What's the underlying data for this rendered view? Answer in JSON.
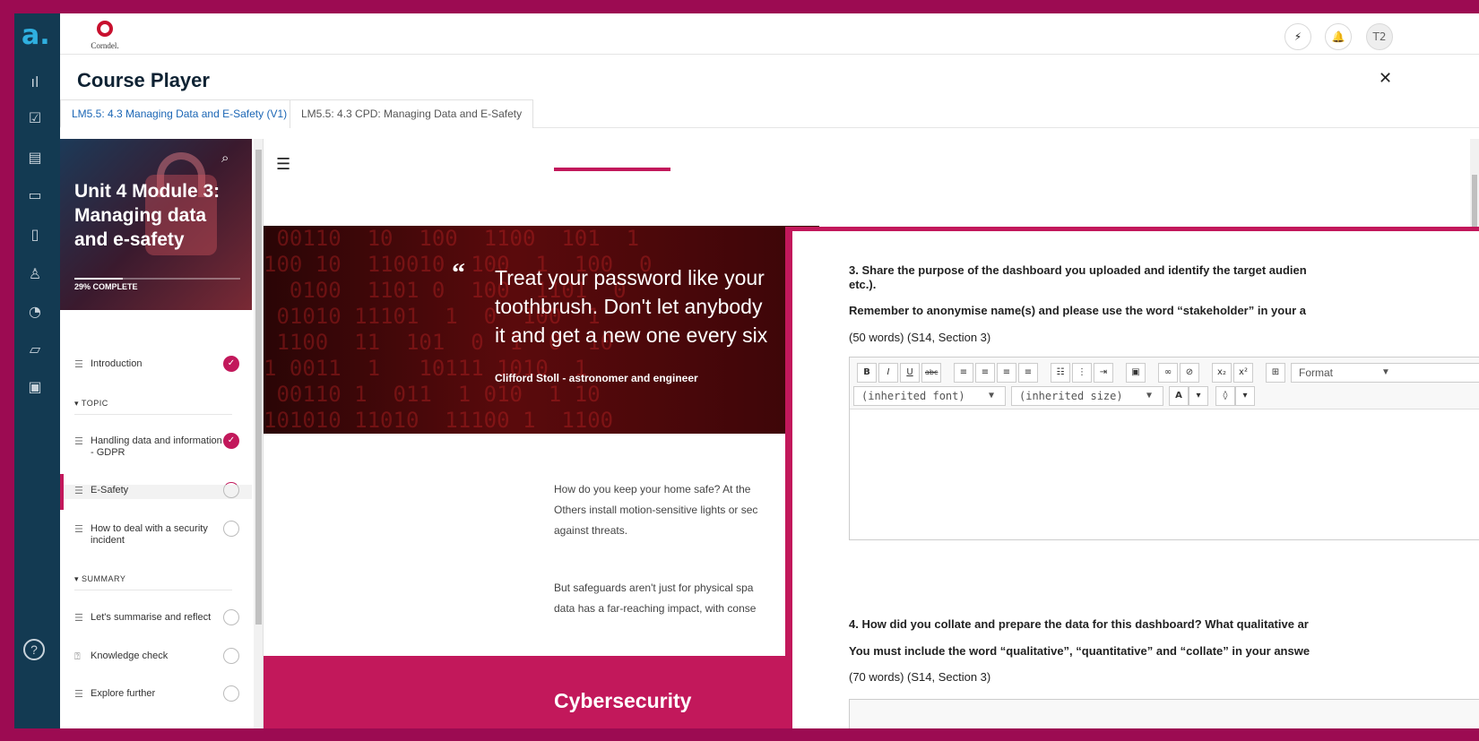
{
  "rail": {
    "logo": "a.",
    "items": [
      "bar-chart-icon",
      "checkbox-icon",
      "clipboard-icon",
      "chat-icon",
      "document-icon",
      "user-icon",
      "pie-chart-icon",
      "badge-icon",
      "video-doc-icon"
    ],
    "glyphs": [
      "ıl",
      "☑",
      "▤",
      "▭",
      "▯",
      "♙",
      "◔",
      "▱",
      "▣"
    ],
    "help": "?"
  },
  "topbar": {
    "brand": "Corndel.",
    "user_initials": "T2",
    "flash_glyph": "⚡",
    "bell_glyph": "🔔"
  },
  "player": {
    "title": "Course Player",
    "close": "✕",
    "tabs": [
      {
        "label": "LM5.5: 4.3 Managing Data and E-Safety (V1)",
        "active": true
      },
      {
        "label": "LM5.5: 4.3 CPD: Managing Data and E-Safety",
        "active": false
      }
    ]
  },
  "course": {
    "title": "Unit 4 Module 3: Managing data and e-safety",
    "progress_label": "29% COMPLETE",
    "progress": 0.29,
    "lessons": [
      {
        "icon": "lines-icon",
        "label": "Introduction",
        "status": "complete"
      },
      {
        "icon": "lines-icon",
        "label": "Handling data and information - GDPR",
        "status": "complete"
      },
      {
        "icon": "lines-icon",
        "label": "E-Safety",
        "status": "in-progress"
      },
      {
        "icon": "lines-icon",
        "label": "How to deal with a security incident",
        "status": "not-started"
      },
      {
        "icon": "lines-icon",
        "label": "Let's summarise and reflect",
        "status": "not-started"
      },
      {
        "icon": "question-box-icon",
        "label": "Knowledge check",
        "status": "not-started"
      },
      {
        "icon": "lines-icon",
        "label": "Explore further",
        "status": "not-started"
      }
    ],
    "sections": [
      "TOPIC",
      "SUMMARY"
    ]
  },
  "content": {
    "quote_lines": [
      "Treat your password like your",
      "toothbrush. Don't let anybody",
      "it and get a new one every six"
    ],
    "quote_author": "Clifford Stoll - astronomer and engineer",
    "para1": [
      "How do you keep your home safe? At the",
      "Others install motion-sensitive lights or sec",
      "against threats."
    ],
    "para2": [
      "But safeguards aren't just for physical spa",
      "data has a far-reaching impact, with conse"
    ],
    "band_title": "Cybersecurity"
  },
  "assignment": {
    "q3": {
      "line1": "3. Share the purpose of the dashboard you uploaded and identify the target audien",
      "line2": "etc.).",
      "instruction": "Remember to anonymise name(s) and please use the word “stakeholder” in your a",
      "meta": "(50 words)  (S14, Section 3)"
    },
    "q4": {
      "line1": "4. How did you collate and prepare the data for this dashboard? What qualitative ar",
      "instruction": "You must include the word “qualitative”, “quantitative” and “collate” in your answe",
      "meta": "(70 words)  (S14, Section 3)"
    },
    "toolbar": {
      "bold": "B",
      "italic": "I",
      "underline": "U",
      "strike": "abc",
      "format": "Format",
      "font": "(inherited font)",
      "size": "(inherited size)",
      "text_color": "A",
      "bg_color": "◊",
      "subscript": "x₂",
      "superscript": "x²"
    }
  },
  "colors": {
    "accent": "#c2185b",
    "rail": "#133a52",
    "frame": "#9c0b52",
    "link": "#1b66b5"
  }
}
